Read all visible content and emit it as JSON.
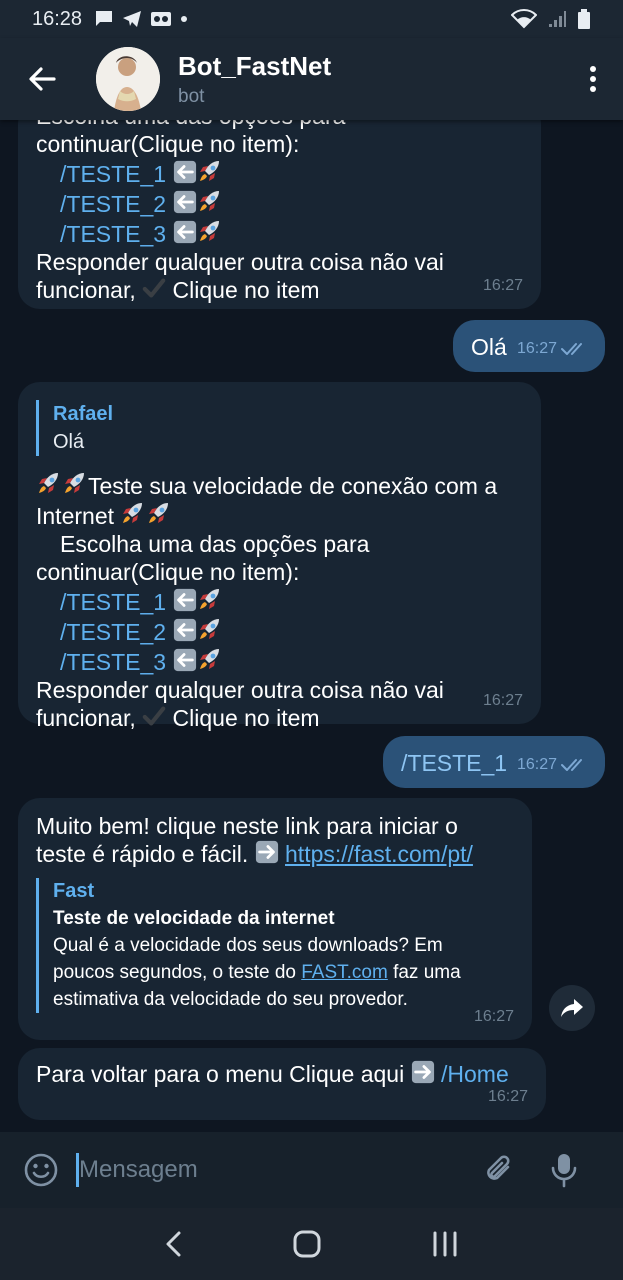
{
  "status_bar": {
    "time": "16:28"
  },
  "header": {
    "title": "Bot_FastNet",
    "subtitle": "bot"
  },
  "messages": {
    "m1": {
      "line0": "  Escolha uma das opções para",
      "line1": "continuar(Clique no item):",
      "cmd1": "/TESTE_1",
      "cmd2": "/TESTE_2",
      "cmd3": "/TESTE_3",
      "line5": "  Responder qualquer outra coisa não vai",
      "line6a": "funcionar,",
      "line6b": " Clique no item",
      "time": "16:27"
    },
    "m2": {
      "text": "Olá",
      "time": "16:27"
    },
    "m3": {
      "reply_name": "Rafael",
      "reply_text": "Olá",
      "line1": "Teste sua velocidade de conexão com a",
      "line2": "Internet",
      "line3": "Escolha uma das opções para",
      "line4": "continuar(Clique no item):",
      "cmd1": "/TESTE_1",
      "cmd2": "/TESTE_2",
      "cmd3": "/TESTE_3",
      "line8": "  Responder qualquer outra coisa não vai",
      "line9a": "funcionar,",
      "line9b": " Clique no item",
      "time": "16:27"
    },
    "m4": {
      "text": "/TESTE_1",
      "time": "16:27"
    },
    "m5": {
      "line1": "Muito bem! clique neste link para iniciar o",
      "line2": "teste é rápido e fácil.",
      "url": "https://fast.com/pt/",
      "preview_site": "Fast",
      "preview_title": "Teste de velocidade da internet",
      "preview_desc1": "Qual é a velocidade dos seus downloads? Em",
      "preview_desc2a": "poucos segundos, o teste do ",
      "preview_desc2_link": "FAST.com",
      "preview_desc2b": " faz uma",
      "preview_desc3": "estimativa da velocidade do seu provedor.",
      "time": "16:27"
    },
    "m6": {
      "text": "Para voltar para o menu Clique aqui",
      "cmd": "/Home",
      "time": "16:27"
    }
  },
  "composer": {
    "placeholder": "Mensagem"
  },
  "icons": {
    "rocket": "rocket-icon",
    "left_arrow": "left-arrow-emoji",
    "right_arrow": "right-arrow-emoji",
    "check": "check-mark-emoji"
  },
  "colors": {
    "background": "#0e1621",
    "incoming": "#182533",
    "outgoing": "#2b5278",
    "accent": "#5fb0ee"
  }
}
